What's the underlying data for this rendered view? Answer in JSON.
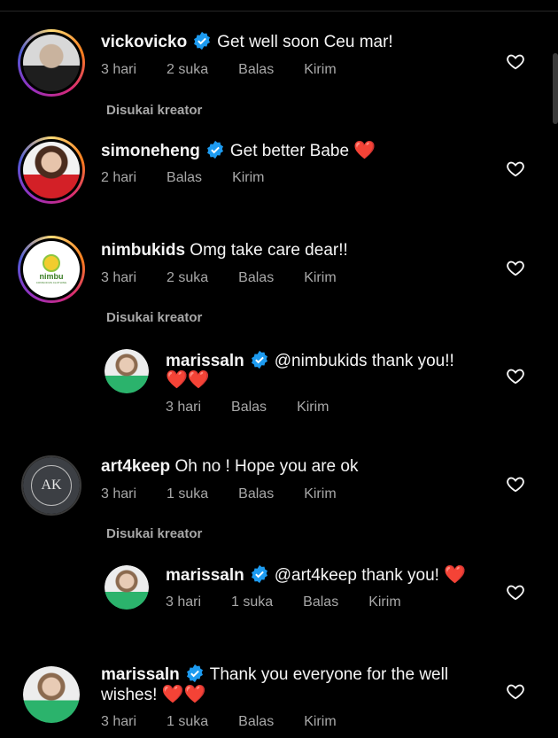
{
  "comments": [
    {
      "username": "vickovicko",
      "text": "Get well soon Ceu mar!",
      "meta": [
        "3 hari",
        "2 suka",
        "Balas",
        "Kirim"
      ],
      "liked_by_creator": "Disukai kreator"
    },
    {
      "username": "simoneheng",
      "text": "Get better Babe",
      "emoji": "❤️",
      "meta": [
        "2 hari",
        "Balas",
        "Kirim"
      ]
    },
    {
      "username": "nimbukids",
      "text": "Omg take care dear!!",
      "meta": [
        "3 hari",
        "2 suka",
        "Balas",
        "Kirim"
      ],
      "liked_by_creator": "Disukai kreator",
      "avatar_text": "nimbu",
      "avatar_subtext": "CONSCIOUS CLOTHING"
    },
    {
      "username": "marissaln",
      "text": "@nimbukids thank you!!",
      "emoji_line": "❤️❤️",
      "meta": [
        "3 hari",
        "Balas",
        "Kirim"
      ]
    },
    {
      "username": "art4keep",
      "text": "Oh no !  Hope you are ok",
      "meta": [
        "3 hari",
        "1 suka",
        "Balas",
        "Kirim"
      ],
      "liked_by_creator": "Disukai kreator",
      "avatar_text": "AK"
    },
    {
      "username": "marissaln",
      "text": "@art4keep thank you!",
      "emoji": "❤️",
      "meta": [
        "3 hari",
        "1 suka",
        "Balas",
        "Kirim"
      ]
    },
    {
      "username": "marissaln",
      "text": "Thank you everyone for the well",
      "text2": "wishes!",
      "emoji": "❤️❤️",
      "meta": [
        "3 hari",
        "1 suka",
        "Balas",
        "Kirim"
      ]
    }
  ],
  "colors": {
    "verified": "#1d9bf0",
    "muted": "#a8a8a8",
    "heart": "#e0245e"
  },
  "icons": {
    "verified": "verified-badge-icon",
    "like": "heart-outline-icon"
  }
}
